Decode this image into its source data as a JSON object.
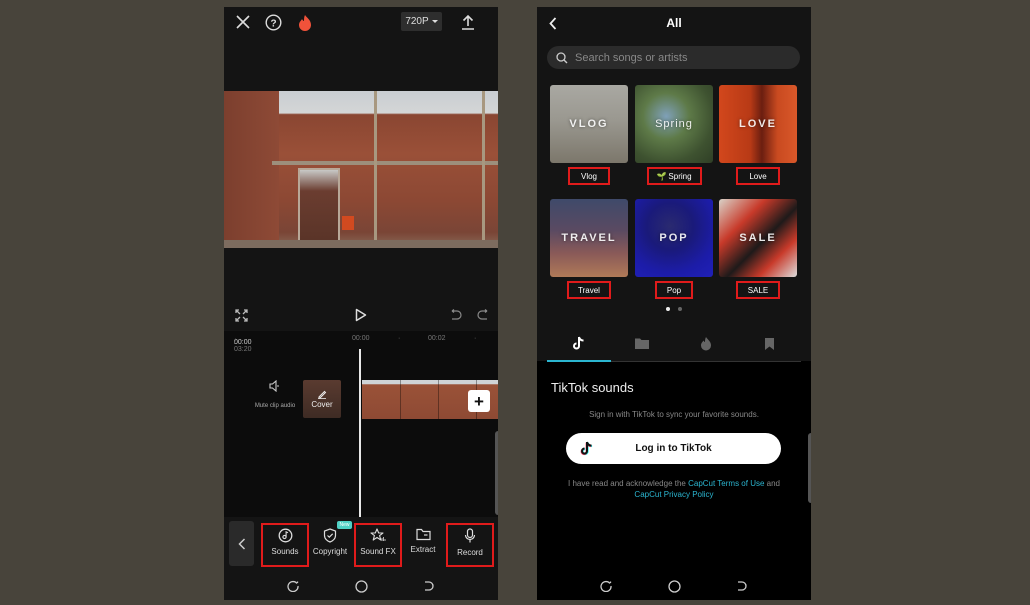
{
  "left_screen": {
    "topbar": {
      "close_icon": "close-icon",
      "help_icon": "help-icon",
      "pro_icon": "flame-icon",
      "resolution": "720P",
      "export_icon": "upload-icon"
    },
    "controls": {
      "fullscreen_icon": "fullscreen-icon",
      "play_icon": "play-icon",
      "undo_icon": "undo-icon",
      "redo_icon": "redo-icon"
    },
    "timeline": {
      "current_time": "00:00",
      "total_time": "/ 03:20",
      "ruler_marks": [
        "00:00",
        "00:02"
      ],
      "mute_label": "Mute clip audio",
      "cover_label": "Cover",
      "add_clip": "+"
    },
    "toolbar": {
      "back_icon": "chevron-left-icon",
      "items": [
        {
          "label": "Sounds",
          "icon": "music-note-icon",
          "highlighted": true
        },
        {
          "label": "Copyright",
          "icon": "shield-check-icon",
          "badge": "New",
          "highlighted": false
        },
        {
          "label": "Sound FX",
          "icon": "star-sound-icon",
          "highlighted": true
        },
        {
          "label": "Extract",
          "icon": "folder-icon",
          "highlighted": false
        },
        {
          "label": "Record",
          "icon": "microphone-icon",
          "highlighted": true
        }
      ]
    }
  },
  "right_screen": {
    "header": {
      "title": "All",
      "back_icon": "chevron-left-icon"
    },
    "search": {
      "placeholder": "Search songs or artists",
      "value": ""
    },
    "categories": [
      {
        "overlay": "VLOG",
        "label": "Vlog",
        "emoji": ""
      },
      {
        "overlay": "Spring",
        "label": "Spring",
        "emoji": "🌱"
      },
      {
        "overlay": "LOVE",
        "label": "Love",
        "emoji": ""
      },
      {
        "overlay": "TRAVEL",
        "label": "Travel",
        "emoji": ""
      },
      {
        "overlay": "POP",
        "label": "Pop",
        "emoji": ""
      },
      {
        "overlay": "SALE",
        "label": "SALE",
        "emoji": ""
      }
    ],
    "pager": {
      "pages": 2,
      "active": 1
    },
    "tabs": [
      {
        "icon": "tiktok-icon",
        "active": true
      },
      {
        "icon": "folder-icon",
        "active": false
      },
      {
        "icon": "flame-icon",
        "active": false
      },
      {
        "icon": "bookmark-icon",
        "active": false
      }
    ],
    "tiktok": {
      "title": "TikTok sounds",
      "description": "Sign in with TikTok to sync your favorite sounds.",
      "login_button": "Log in to TikTok",
      "legal_prefix": "I have read and acknowledge the ",
      "terms_link": "CapCut Terms of Use",
      "legal_and": " and ",
      "privacy_link": "CapCut Privacy Policy"
    }
  },
  "navbar": {
    "recents_icon": "recents-icon",
    "home_icon": "home-circle-icon",
    "back_icon": "back-gesture-icon"
  },
  "colors": {
    "highlight_box": "#e01b1b",
    "accent_link": "#2bb5d0",
    "new_badge": "#4fd1c5",
    "flame": "#f0523a",
    "backdrop": "#48443b"
  }
}
